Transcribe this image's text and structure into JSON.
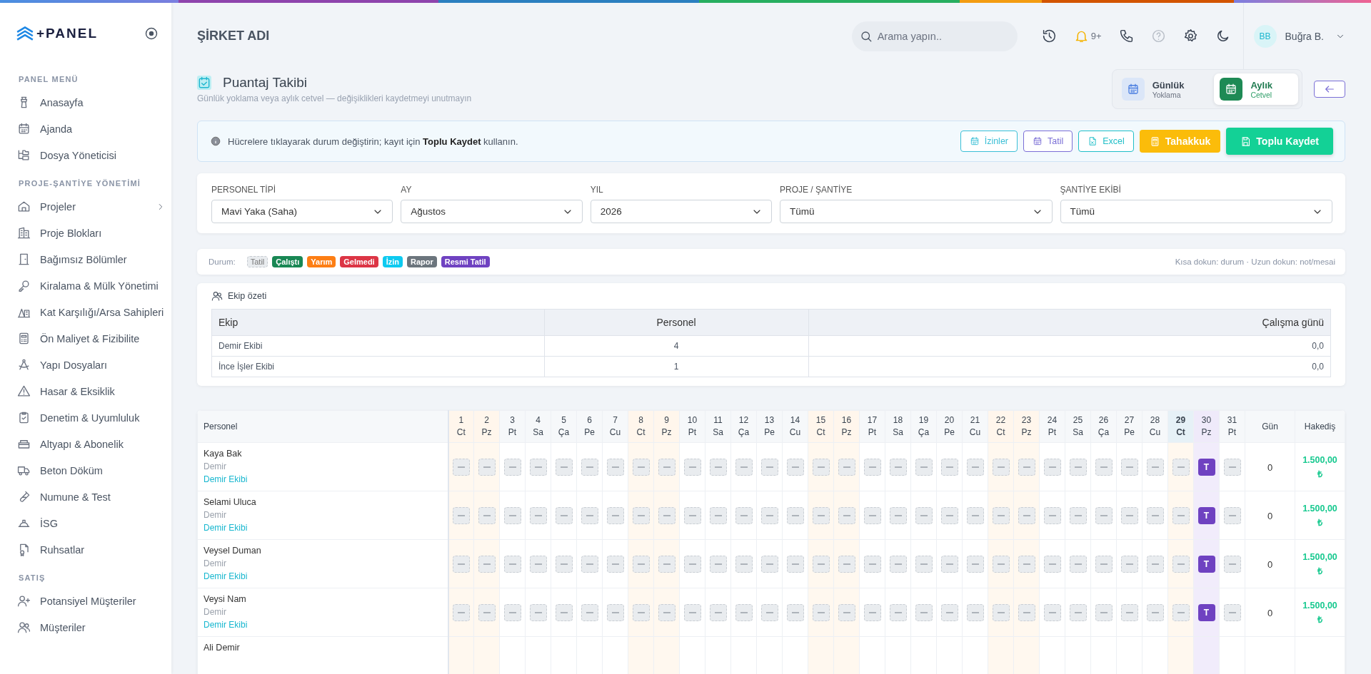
{
  "sidebar": {
    "logo": "+PANEL",
    "sections": [
      {
        "title": "PANEL MENÜ",
        "items": [
          {
            "label": "Anasayfa",
            "submenu": false
          },
          {
            "label": "Ajanda",
            "submenu": false
          },
          {
            "label": "Dosya Yöneticisi",
            "submenu": false
          }
        ]
      },
      {
        "title": "PROJE-ŞANTİYE YÖNETİMİ",
        "items": [
          {
            "label": "Projeler",
            "submenu": true
          },
          {
            "label": "Proje Blokları",
            "submenu": false
          },
          {
            "label": "Bağımsız Bölümler",
            "submenu": false
          },
          {
            "label": "Kiralama & Mülk Yönetimi",
            "submenu": false
          },
          {
            "label": "Kat Karşılığı/Arsa Sahipleri",
            "submenu": false
          },
          {
            "label": "Ön Maliyet & Fizibilite",
            "submenu": false
          },
          {
            "label": "Yapı Dosyaları",
            "submenu": false
          },
          {
            "label": "Hasar & Eksiklik",
            "submenu": false
          },
          {
            "label": "Denetim & Uyumluluk",
            "submenu": false
          },
          {
            "label": "Altyapı & Abonelik",
            "submenu": false
          },
          {
            "label": "Beton Döküm",
            "submenu": false
          },
          {
            "label": "Numune & Test",
            "submenu": false
          },
          {
            "label": "İSG",
            "submenu": false
          },
          {
            "label": "Ruhsatlar",
            "submenu": false
          }
        ]
      },
      {
        "title": "SATIŞ",
        "items": [
          {
            "label": "Potansiyel Müşteriler",
            "submenu": false
          },
          {
            "label": "Müşteriler",
            "submenu": false
          }
        ]
      }
    ]
  },
  "topbar": {
    "company": "ŞİRKET ADI",
    "search": {
      "placeholder": "Arama yapın.."
    },
    "notifications": "9+",
    "user": {
      "initials": "BB",
      "name": "Buğra B."
    }
  },
  "page": {
    "title": "Puantaj Takibi",
    "subtitle": "Günlük yoklama veya aylık cetvel — değişiklikleri kaydetmeyi unutmayın",
    "view_toggle": [
      {
        "title": "Günlük",
        "subtitle": "Yoklama",
        "selected": false
      },
      {
        "title": "Aylık",
        "subtitle": "Cetvel",
        "selected": true
      }
    ]
  },
  "toolbar": {
    "info": "Hücrelere tıklayarak durum değiştirin; kayıt için **Toplu Kaydet** kullanın.",
    "buttons": [
      {
        "label": "İzinler",
        "kind": "outline",
        "color": "#3bbfd6"
      },
      {
        "label": "Tatil",
        "kind": "outline",
        "color": "#7b6fd6"
      },
      {
        "label": "Excel",
        "kind": "outline",
        "color": "#20bfc8"
      },
      {
        "label": "Tahakkuk",
        "kind": "solid",
        "color": "#fbbc0a"
      },
      {
        "label": "Toplu Kaydet",
        "kind": "primary",
        "color": "#13d196"
      }
    ]
  },
  "filters": [
    {
      "label": "PERSONEL TİPİ",
      "value": "Mavi Yaka (Saha)"
    },
    {
      "label": "AY",
      "value": "Ağustos"
    },
    {
      "label": "YIL",
      "value": "2026"
    },
    {
      "label": "PROJE / ŞANTİYE",
      "value": "Tümü"
    },
    {
      "label": "ŞANTİYE EKİBİ",
      "value": "Tümü"
    }
  ],
  "legend": {
    "label": "Durum:",
    "items": [
      {
        "label": "Tatil",
        "color": "#e9ecef"
      },
      {
        "label": "Çalıştı",
        "color": "#198754"
      },
      {
        "label": "Yarım",
        "color": "#fd7e14"
      },
      {
        "label": "Gelmedi",
        "color": "#dc3545"
      },
      {
        "label": "İzin",
        "color": "#0dcaf0"
      },
      {
        "label": "Rapor",
        "color": "#6c757d"
      },
      {
        "label": "Resmi Tatil",
        "color": "#6f42c1"
      }
    ],
    "hint": "Kısa dokun: durum · Uzun dokun: not/mesai"
  },
  "summary": {
    "title": "Ekip özeti",
    "columns": [
      "Ekip",
      "Personel",
      "Çalışma günü"
    ],
    "rows": [
      [
        "Demir Ekibi",
        "4",
        "0,0"
      ],
      [
        "İnce İşler Ekibi",
        "1",
        "0,0"
      ]
    ]
  },
  "grid": {
    "person_column": "Personel",
    "total_column": "Gün",
    "pay_column": "Hakediş",
    "days": [
      {
        "day": "1",
        "dow": "Ct",
        "weekend": true,
        "today": false,
        "holiday": false
      },
      {
        "day": "2",
        "dow": "Pz",
        "weekend": true,
        "today": false,
        "holiday": false
      },
      {
        "day": "3",
        "dow": "Pt",
        "weekend": false,
        "today": false,
        "holiday": false
      },
      {
        "day": "4",
        "dow": "Sa",
        "weekend": false,
        "today": false,
        "holiday": false
      },
      {
        "day": "5",
        "dow": "Ça",
        "weekend": false,
        "today": false,
        "holiday": false
      },
      {
        "day": "6",
        "dow": "Pe",
        "weekend": false,
        "today": false,
        "holiday": false
      },
      {
        "day": "7",
        "dow": "Cu",
        "weekend": false,
        "today": false,
        "holiday": false
      },
      {
        "day": "8",
        "dow": "Ct",
        "weekend": true,
        "today": false,
        "holiday": false
      },
      {
        "day": "9",
        "dow": "Pz",
        "weekend": true,
        "today": false,
        "holiday": false
      },
      {
        "day": "10",
        "dow": "Pt",
        "weekend": false,
        "today": false,
        "holiday": false
      },
      {
        "day": "11",
        "dow": "Sa",
        "weekend": false,
        "today": false,
        "holiday": false
      },
      {
        "day": "12",
        "dow": "Ça",
        "weekend": false,
        "today": false,
        "holiday": false
      },
      {
        "day": "13",
        "dow": "Pe",
        "weekend": false,
        "today": false,
        "holiday": false
      },
      {
        "day": "14",
        "dow": "Cu",
        "weekend": false,
        "today": false,
        "holiday": false
      },
      {
        "day": "15",
        "dow": "Ct",
        "weekend": true,
        "today": false,
        "holiday": false
      },
      {
        "day": "16",
        "dow": "Pz",
        "weekend": true,
        "today": false,
        "holiday": false
      },
      {
        "day": "17",
        "dow": "Pt",
        "weekend": false,
        "today": false,
        "holiday": false
      },
      {
        "day": "18",
        "dow": "Sa",
        "weekend": false,
        "today": false,
        "holiday": false
      },
      {
        "day": "19",
        "dow": "Ça",
        "weekend": false,
        "today": false,
        "holiday": false
      },
      {
        "day": "20",
        "dow": "Pe",
        "weekend": false,
        "today": false,
        "holiday": false
      },
      {
        "day": "21",
        "dow": "Cu",
        "weekend": false,
        "today": false,
        "holiday": false
      },
      {
        "day": "22",
        "dow": "Ct",
        "weekend": true,
        "today": false,
        "holiday": false
      },
      {
        "day": "23",
        "dow": "Pz",
        "weekend": true,
        "today": false,
        "holiday": false
      },
      {
        "day": "24",
        "dow": "Pt",
        "weekend": false,
        "today": false,
        "holiday": false
      },
      {
        "day": "25",
        "dow": "Sa",
        "weekend": false,
        "today": false,
        "holiday": false
      },
      {
        "day": "26",
        "dow": "Ça",
        "weekend": false,
        "today": false,
        "holiday": false
      },
      {
        "day": "27",
        "dow": "Pe",
        "weekend": false,
        "today": false,
        "holiday": false
      },
      {
        "day": "28",
        "dow": "Cu",
        "weekend": false,
        "today": false,
        "holiday": false
      },
      {
        "day": "29",
        "dow": "Ct",
        "weekend": true,
        "today": true,
        "holiday": false
      },
      {
        "day": "30",
        "dow": "Pz",
        "weekend": false,
        "today": false,
        "holiday": true
      },
      {
        "day": "31",
        "dow": "Pt",
        "weekend": false,
        "today": false,
        "holiday": false
      }
    ],
    "rows": [
      {
        "name": "Kaya Bak",
        "role": "Demir",
        "team": "Demir Ekibi",
        "cells": [
          {
            "kind": "empty"
          },
          {
            "kind": "empty"
          },
          {
            "kind": "empty"
          },
          {
            "kind": "empty"
          },
          {
            "kind": "empty"
          },
          {
            "kind": "empty"
          },
          {
            "kind": "empty"
          },
          {
            "kind": "empty"
          },
          {
            "kind": "empty"
          },
          {
            "kind": "empty"
          },
          {
            "kind": "empty"
          },
          {
            "kind": "empty"
          },
          {
            "kind": "empty"
          },
          {
            "kind": "empty"
          },
          {
            "kind": "empty"
          },
          {
            "kind": "empty"
          },
          {
            "kind": "empty"
          },
          {
            "kind": "empty"
          },
          {
            "kind": "empty"
          },
          {
            "kind": "empty"
          },
          {
            "kind": "empty"
          },
          {
            "kind": "empty"
          },
          {
            "kind": "empty"
          },
          {
            "kind": "empty"
          },
          {
            "kind": "empty"
          },
          {
            "kind": "empty"
          },
          {
            "kind": "empty"
          },
          {
            "kind": "empty"
          },
          {
            "kind": "empty"
          },
          {
            "kind": "official_holiday",
            "text": "T"
          },
          {
            "kind": "empty"
          }
        ],
        "total": "0",
        "pay": "1.500,00 ₺"
      },
      {
        "name": "Selami Uluca",
        "role": "Demir",
        "team": "Demir Ekibi",
        "cells": [
          {
            "kind": "empty"
          },
          {
            "kind": "empty"
          },
          {
            "kind": "empty"
          },
          {
            "kind": "empty"
          },
          {
            "kind": "empty"
          },
          {
            "kind": "empty"
          },
          {
            "kind": "empty"
          },
          {
            "kind": "empty"
          },
          {
            "kind": "empty"
          },
          {
            "kind": "empty"
          },
          {
            "kind": "empty"
          },
          {
            "kind": "empty"
          },
          {
            "kind": "empty"
          },
          {
            "kind": "empty"
          },
          {
            "kind": "empty"
          },
          {
            "kind": "empty"
          },
          {
            "kind": "empty"
          },
          {
            "kind": "empty"
          },
          {
            "kind": "empty"
          },
          {
            "kind": "empty"
          },
          {
            "kind": "empty"
          },
          {
            "kind": "empty"
          },
          {
            "kind": "empty"
          },
          {
            "kind": "empty"
          },
          {
            "kind": "empty"
          },
          {
            "kind": "empty"
          },
          {
            "kind": "empty"
          },
          {
            "kind": "empty"
          },
          {
            "kind": "empty"
          },
          {
            "kind": "official_holiday",
            "text": "T"
          },
          {
            "kind": "empty"
          }
        ],
        "total": "0",
        "pay": "1.500,00 ₺"
      },
      {
        "name": "Veysel Duman",
        "role": "Demir",
        "team": "Demir Ekibi",
        "cells": [
          {
            "kind": "empty"
          },
          {
            "kind": "empty"
          },
          {
            "kind": "empty"
          },
          {
            "kind": "empty"
          },
          {
            "kind": "empty"
          },
          {
            "kind": "empty"
          },
          {
            "kind": "empty"
          },
          {
            "kind": "empty"
          },
          {
            "kind": "empty"
          },
          {
            "kind": "empty"
          },
          {
            "kind": "empty"
          },
          {
            "kind": "empty"
          },
          {
            "kind": "empty"
          },
          {
            "kind": "empty"
          },
          {
            "kind": "empty"
          },
          {
            "kind": "empty"
          },
          {
            "kind": "empty"
          },
          {
            "kind": "empty"
          },
          {
            "kind": "empty"
          },
          {
            "kind": "empty"
          },
          {
            "kind": "empty"
          },
          {
            "kind": "empty"
          },
          {
            "kind": "empty"
          },
          {
            "kind": "empty"
          },
          {
            "kind": "empty"
          },
          {
            "kind": "empty"
          },
          {
            "kind": "empty"
          },
          {
            "kind": "empty"
          },
          {
            "kind": "empty"
          },
          {
            "kind": "official_holiday",
            "text": "T"
          },
          {
            "kind": "empty"
          }
        ],
        "total": "0",
        "pay": "1.500,00 ₺"
      },
      {
        "name": "Veysi Nam",
        "role": "Demir",
        "team": "Demir Ekibi",
        "cells": [
          {
            "kind": "empty"
          },
          {
            "kind": "empty"
          },
          {
            "kind": "empty"
          },
          {
            "kind": "empty"
          },
          {
            "kind": "empty"
          },
          {
            "kind": "empty"
          },
          {
            "kind": "empty"
          },
          {
            "kind": "empty"
          },
          {
            "kind": "empty"
          },
          {
            "kind": "empty"
          },
          {
            "kind": "empty"
          },
          {
            "kind": "empty"
          },
          {
            "kind": "empty"
          },
          {
            "kind": "empty"
          },
          {
            "kind": "empty"
          },
          {
            "kind": "empty"
          },
          {
            "kind": "empty"
          },
          {
            "kind": "empty"
          },
          {
            "kind": "empty"
          },
          {
            "kind": "empty"
          },
          {
            "kind": "empty"
          },
          {
            "kind": "empty"
          },
          {
            "kind": "empty"
          },
          {
            "kind": "empty"
          },
          {
            "kind": "empty"
          },
          {
            "kind": "empty"
          },
          {
            "kind": "empty"
          },
          {
            "kind": "empty"
          },
          {
            "kind": "empty"
          },
          {
            "kind": "official_holiday",
            "text": "T"
          },
          {
            "kind": "empty"
          }
        ],
        "total": "0",
        "pay": "1.500,00 ₺"
      },
      {
        "name": "Ali Demir"
      }
    ]
  }
}
